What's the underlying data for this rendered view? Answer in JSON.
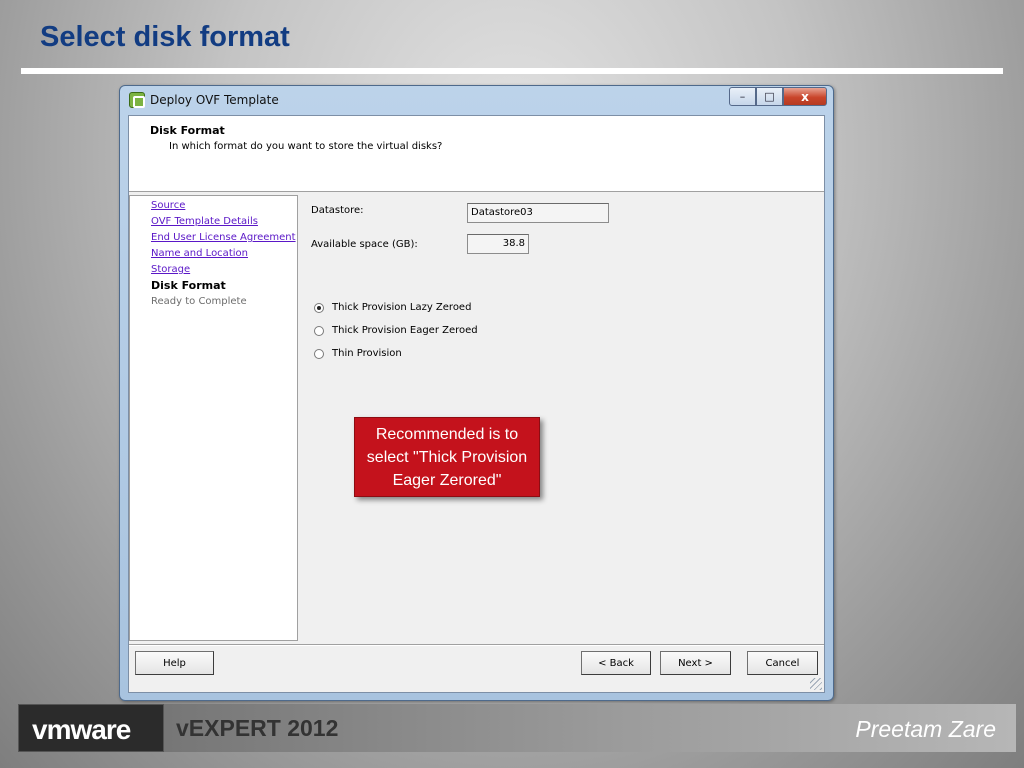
{
  "slide": {
    "title": "Select disk format"
  },
  "window": {
    "title": "Deploy OVF Template",
    "controls": {
      "minimize": "–",
      "maximize": "□",
      "close": "x"
    },
    "header": {
      "title": "Disk Format",
      "subtitle": "In which format do you want to store the virtual disks?"
    },
    "steps": [
      {
        "label": "Source",
        "state": "link"
      },
      {
        "label": "OVF Template Details",
        "state": "link"
      },
      {
        "label": "End User License Agreement",
        "state": "link"
      },
      {
        "label": "Name and Location",
        "state": "link"
      },
      {
        "label": "Storage",
        "state": "link"
      },
      {
        "label": "Disk Format",
        "state": "current"
      },
      {
        "label": "Ready to Complete",
        "state": "pending"
      }
    ],
    "form": {
      "datastore_label": "Datastore:",
      "datastore_value": "Datastore03",
      "space_label": "Available space (GB):",
      "space_value": "38.8"
    },
    "options": [
      {
        "label": "Thick Provision Lazy Zeroed",
        "checked": true
      },
      {
        "label": "Thick Provision Eager Zeroed",
        "checked": false
      },
      {
        "label": "Thin Provision",
        "checked": false
      }
    ],
    "callout": "Recommended is to\nselect \"Thick Provision\nEager Zerored\"",
    "buttons": {
      "help": "Help",
      "back": "< Back",
      "next": "Next >",
      "cancel": "Cancel"
    }
  },
  "footer": {
    "logo": "vmware",
    "badge": "vEXPERT 2012",
    "author": "Preetam Zare"
  }
}
